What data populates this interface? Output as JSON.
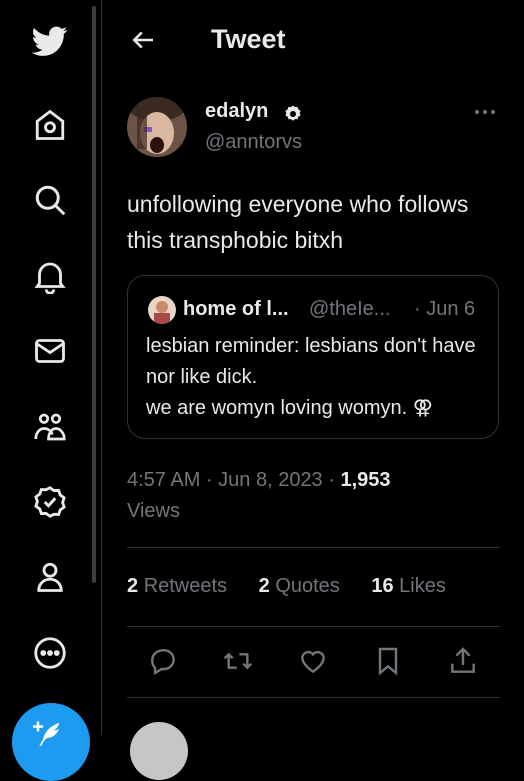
{
  "sidebar": {
    "items": [
      "twitter-logo-icon",
      "home-icon",
      "search-icon",
      "bell-icon",
      "mail-icon",
      "communities-icon",
      "verified-icon",
      "profile-icon",
      "more-circle-icon"
    ],
    "compose_icon": "compose-tweet-icon"
  },
  "header": {
    "title": "Tweet"
  },
  "tweet": {
    "name": "edalyn",
    "handle": "@anntorvs",
    "text": "unfollowing everyone who follows this transphobic bitxh",
    "time": "4:57 AM · Jun 8, 2023 · ",
    "views_count": "1,953",
    "views_label": "Views"
  },
  "quote": {
    "name": "home of l...",
    "handle": "@theIe...",
    "date": "· Jun 6",
    "line1": "lesbian reminder: lesbians don't have nor like dick.",
    "line2": "we are womyn loving womyn. ⚢"
  },
  "stats": {
    "retweets_count": "2",
    "retweets_label": "Retweets",
    "quotes_count": "2",
    "quotes_label": "Quotes",
    "likes_count": "16",
    "likes_label": "Likes"
  },
  "colors": {
    "background": "#000000",
    "text": "#e7e9ea",
    "muted": "#71767b",
    "accent": "#1d9bf0",
    "border": "#2f3336"
  }
}
